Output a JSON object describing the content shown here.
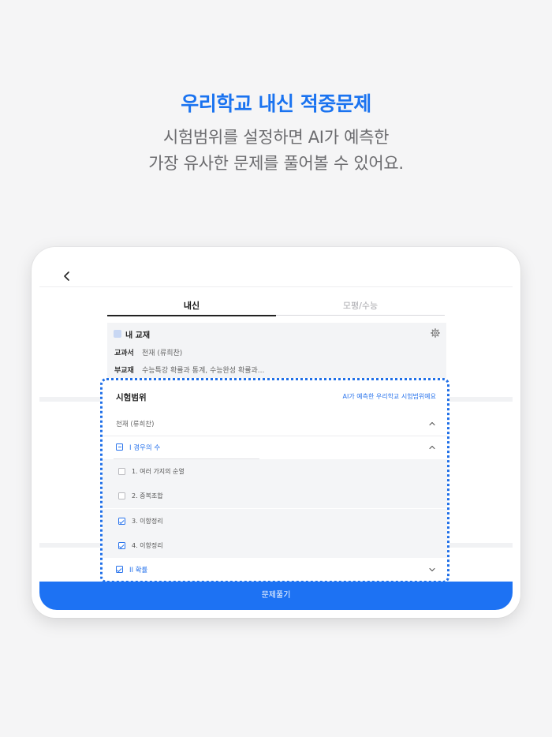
{
  "headline": "우리학교 내신 적중문제",
  "subline": [
    "시험범위를 설정하면 AI가 예측한",
    "가장 유사한 문제를 풀어볼 수 있어요."
  ],
  "tabs": [
    {
      "label": "내신",
      "active": true
    },
    {
      "label": "모평/수능",
      "active": false
    }
  ],
  "textbook": {
    "title": "내 교재",
    "rows": [
      {
        "label": "교과서",
        "value": "천재 (류희찬)"
      },
      {
        "label": "부교재",
        "value": "수능특강 확률과 통계, 수능완성 확률과..."
      }
    ]
  },
  "range": {
    "title": "시험범위",
    "link": "AI가 예측한 우리학교 시험범위예요",
    "book": "천재 (류희찬)",
    "unit1": {
      "label": "I 경우의 수",
      "lessons": [
        {
          "label": "1. 여러 가지의 순열",
          "checked": false
        },
        {
          "label": "2. 중복조합",
          "checked": false
        },
        {
          "label": "3. 이항정리",
          "checked": true
        },
        {
          "label": "4. 이항정리",
          "checked": true
        }
      ]
    },
    "unit2": {
      "label": "II 확률",
      "checked": true
    }
  },
  "button": "문제풀기",
  "colors": {
    "accent": "#1d72f3",
    "text": "#222222"
  }
}
